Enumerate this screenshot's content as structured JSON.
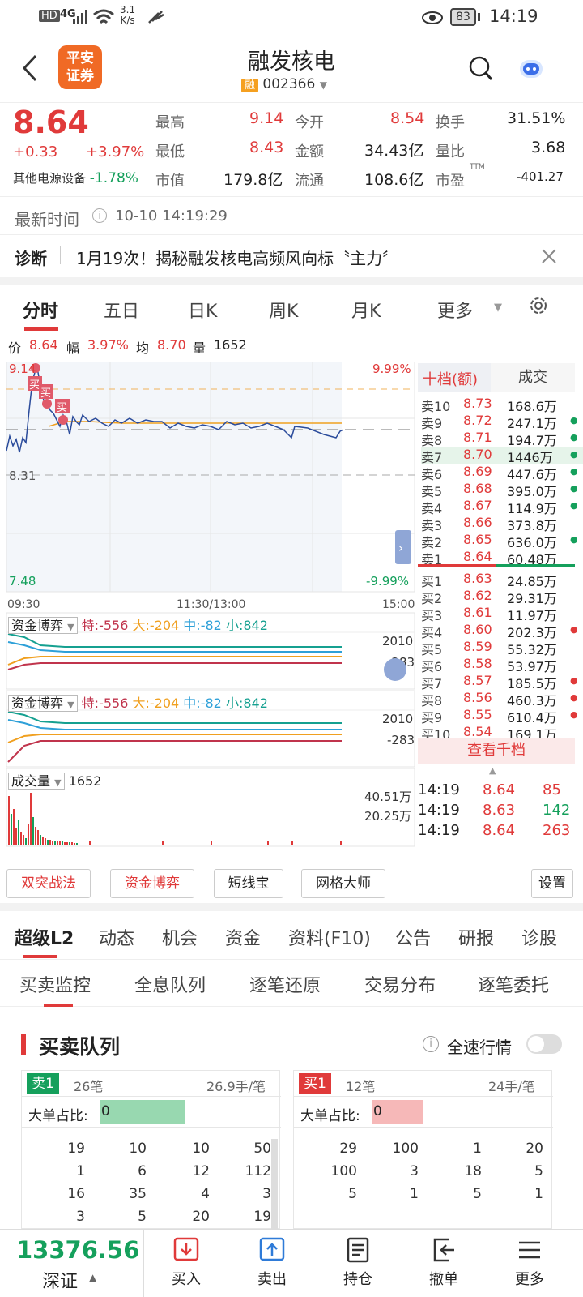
{
  "status": {
    "hd": "HD",
    "net": "4G",
    "speed": "3.1\nK/s",
    "speed_top": "3.1",
    "speed_bottom": "K/s",
    "battery": "83",
    "time": "14:19"
  },
  "nav": {
    "logo_top": "平安",
    "logo_bottom": "证券",
    "title": "融发核电",
    "badge": "融",
    "code": "002366"
  },
  "quote": {
    "price": "8.64",
    "change": "+0.33",
    "pct": "+3.97%",
    "sector": "其他电源设备",
    "sector_pct": "-1.78%",
    "high_l": "最高",
    "high": "9.14",
    "open_l": "今开",
    "open": "8.54",
    "turn_l": "换手",
    "turn": "31.51%",
    "low_l": "最低",
    "low": "8.43",
    "amt_l": "金额",
    "amt": "34.43亿",
    "vr_l": "量比",
    "vr": "3.68",
    "mcap_l": "市值",
    "mcap": "179.8亿",
    "float_l": "流通",
    "float": "108.6亿",
    "pe_l": "市盈",
    "pe_sup": "TTM",
    "pe": "-401.27"
  },
  "latest": {
    "label": "最新时间",
    "time": "10-10 14:19:29"
  },
  "diag": {
    "label": "诊断",
    "text": "1月19次！揭秘融发核电高频风向标〝主力〞"
  },
  "tabs1": [
    "分时",
    "五日",
    "日K",
    "周K",
    "月K",
    "更多"
  ],
  "pricebar": {
    "p_l": "价",
    "p": "8.64",
    "f_l": "幅",
    "f": "3.97%",
    "a_l": "均",
    "a": "8.70",
    "v_l": "量",
    "v": "1652"
  },
  "chart_labels": {
    "top_price": "9.14",
    "top_pct": "9.99%",
    "mid": "8.31",
    "bot_price": "7.48",
    "bot_pct": "-9.99%",
    "t0": "09:30",
    "t1": "11:30/13:00",
    "t2": "15:00",
    "buy": "买"
  },
  "fund1": {
    "title": "资金博弈",
    "te_l": "特:",
    "te": "-556",
    "da_l": "大:",
    "da": "-204",
    "zh_l": "中:",
    "zh": "-82",
    "xi_l": "小:",
    "xi": "842",
    "top": "2010",
    "bot": "-283"
  },
  "vol": {
    "title": "成交量",
    "value": "1652",
    "v1": "40.51万",
    "v2": "20.25万"
  },
  "orderbook": {
    "h1": "十档(额)",
    "h2": "成交",
    "sells": [
      [
        "卖10",
        "8.73",
        "168.6万",
        ""
      ],
      [
        "卖9",
        "8.72",
        "247.1万",
        "g"
      ],
      [
        "卖8",
        "8.71",
        "194.7万",
        "g"
      ],
      [
        "卖7",
        "8.70",
        "1446万",
        "g"
      ],
      [
        "卖6",
        "8.69",
        "447.6万",
        "g"
      ],
      [
        "卖5",
        "8.68",
        "395.0万",
        "g"
      ],
      [
        "卖4",
        "8.67",
        "114.9万",
        "g"
      ],
      [
        "卖3",
        "8.66",
        "373.8万",
        ""
      ],
      [
        "卖2",
        "8.65",
        "636.0万",
        "g"
      ],
      [
        "卖1",
        "8.64",
        "60.48万",
        ""
      ]
    ],
    "buys": [
      [
        "买1",
        "8.63",
        "24.85万",
        ""
      ],
      [
        "买2",
        "8.62",
        "29.31万",
        ""
      ],
      [
        "买3",
        "8.61",
        "11.97万",
        ""
      ],
      [
        "买4",
        "8.60",
        "202.3万",
        "r"
      ],
      [
        "买5",
        "8.59",
        "55.32万",
        ""
      ],
      [
        "买6",
        "8.58",
        "53.97万",
        ""
      ],
      [
        "买7",
        "8.57",
        "185.5万",
        "r"
      ],
      [
        "买8",
        "8.56",
        "460.3万",
        "r"
      ],
      [
        "买9",
        "8.55",
        "610.4万",
        "r"
      ],
      [
        "买10",
        "8.54",
        "169.1万",
        ""
      ]
    ],
    "more": "查看千档",
    "trades": [
      [
        "14:19",
        "8.64",
        "85",
        "r"
      ],
      [
        "14:19",
        "8.63",
        "142",
        "g"
      ],
      [
        "14:19",
        "8.64",
        "263",
        "r"
      ]
    ]
  },
  "fbtns": [
    "双突战法",
    "资金博弈",
    "短线宝",
    "网格大师",
    "设置"
  ],
  "tabs2": [
    "超级L2",
    "动态",
    "机会",
    "资金",
    "资料(F10)",
    "公告",
    "研报",
    "诊股"
  ],
  "tabs3": [
    "买卖监控",
    "全息队列",
    "逐笔还原",
    "交易分布",
    "逐笔委托"
  ],
  "queue": {
    "title": "买卖队列",
    "fast": "全速行情",
    "left": {
      "tag": "卖1",
      "count": "26笔",
      "avg": "26.9手/笔",
      "ratio_l": "大单占比:",
      "ratio": "0",
      "ratio_frac": 0.5,
      "rows": [
        [
          "19",
          "10",
          "10",
          "50"
        ],
        [
          "1",
          "6",
          "12",
          "112"
        ],
        [
          "16",
          "35",
          "4",
          "3"
        ],
        [
          "3",
          "5",
          "20",
          "19"
        ]
      ]
    },
    "right": {
      "tag": "买1",
      "count": "12笔",
      "avg": "24手/笔",
      "ratio_l": "大单占比:",
      "ratio": "0",
      "ratio_frac": 0.3,
      "rows": [
        [
          "29",
          "100",
          "1",
          "20"
        ],
        [
          "100",
          "3",
          "18",
          "5"
        ],
        [
          "5",
          "1",
          "5",
          "1"
        ]
      ]
    }
  },
  "bottom": {
    "index_val": "13376.56",
    "index_name": "深证",
    "items": [
      "买入",
      "卖出",
      "持仓",
      "撤单",
      "更多"
    ]
  },
  "colors": {
    "red": "#e03a3a",
    "green": "#15a05c",
    "orange": "#f08a1c"
  }
}
